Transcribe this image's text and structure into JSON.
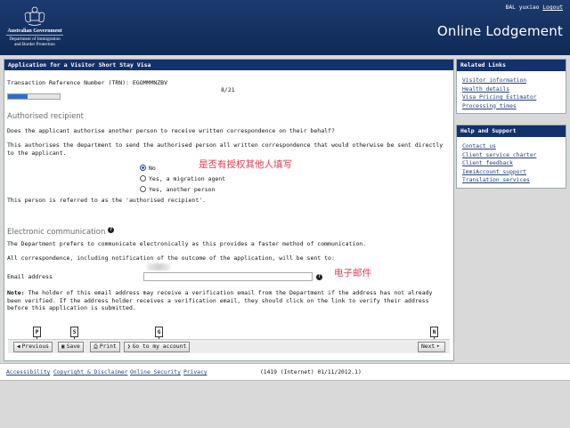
{
  "header": {
    "gov_line1": "Australian Government",
    "gov_line2": "Department of Immigration",
    "gov_line3": "and Border Protection",
    "user_prefix": "BAL yuxiao",
    "logout_label": "Logout",
    "brand": "Online Lodgement"
  },
  "main": {
    "title": "Application for a Visitor Short Stay Visa",
    "trn": "Transaction Reference Number (TRN): EGOMMMNZBV",
    "page_indicator": "8/21",
    "progress_fraction": 0.38,
    "authorised": {
      "heading": "Authorised recipient",
      "question": "Does the applicant authorise another person to receive written correspondence on their behalf?",
      "explanation": "This authorises the department to send the authorised person all written correspondence that would otherwise be sent directly to the applicant.",
      "options": [
        "No",
        "Yes, a migration agent",
        "Yes, another person"
      ],
      "selected_option": "No",
      "annotation": "是否有授权其他人填写",
      "referred_text": "This person is referred to as the 'authorised recipient'."
    },
    "electronic": {
      "heading": "Electronic communication",
      "prefers_text": "The Department prefers to communicate electronically as this provides a faster method of communication.",
      "all_corr_text": "All correspondence, including notification of the outcome of the application, will be sent to:",
      "email_label": "Email address",
      "email_value": "",
      "annotation": "电子邮件",
      "note_label": "Note:",
      "note_text": "The holder of this email address may receive a verification email from the Department if the address has not already been verified. If the address holder receives a verification email, they should click on the link to verify their address before this application is submitted."
    },
    "buttons": {
      "previous": "Previous",
      "save": "Save",
      "print": "Print",
      "go_to_account": "Go to my account",
      "next": "Next"
    },
    "shortcut_keys": {
      "previous": "P",
      "save": "S",
      "go_to_account": "G",
      "next": "N"
    }
  },
  "related_links": {
    "title": "Related Links",
    "items": [
      "Visitor information",
      "Health details",
      "Visa Pricing Estimator",
      "Processing times"
    ]
  },
  "help_support": {
    "title": "Help and Support",
    "items": [
      "Contact us",
      "Client service charter",
      "Client feedback",
      "ImmiAccount support",
      "Translation services"
    ]
  },
  "footer": {
    "links": [
      "Accessibility",
      "Copyright & Disclaimer",
      "Online Security",
      "Privacy"
    ],
    "version": "(1419 (Internet) 01/11/2012.1)"
  },
  "colors": {
    "header_bg": "#1c3a6e",
    "panel_title_bg": "#13316a",
    "link": "#23407a",
    "annotation": "#e23a52",
    "progress_fill": "#2f6fc7"
  }
}
